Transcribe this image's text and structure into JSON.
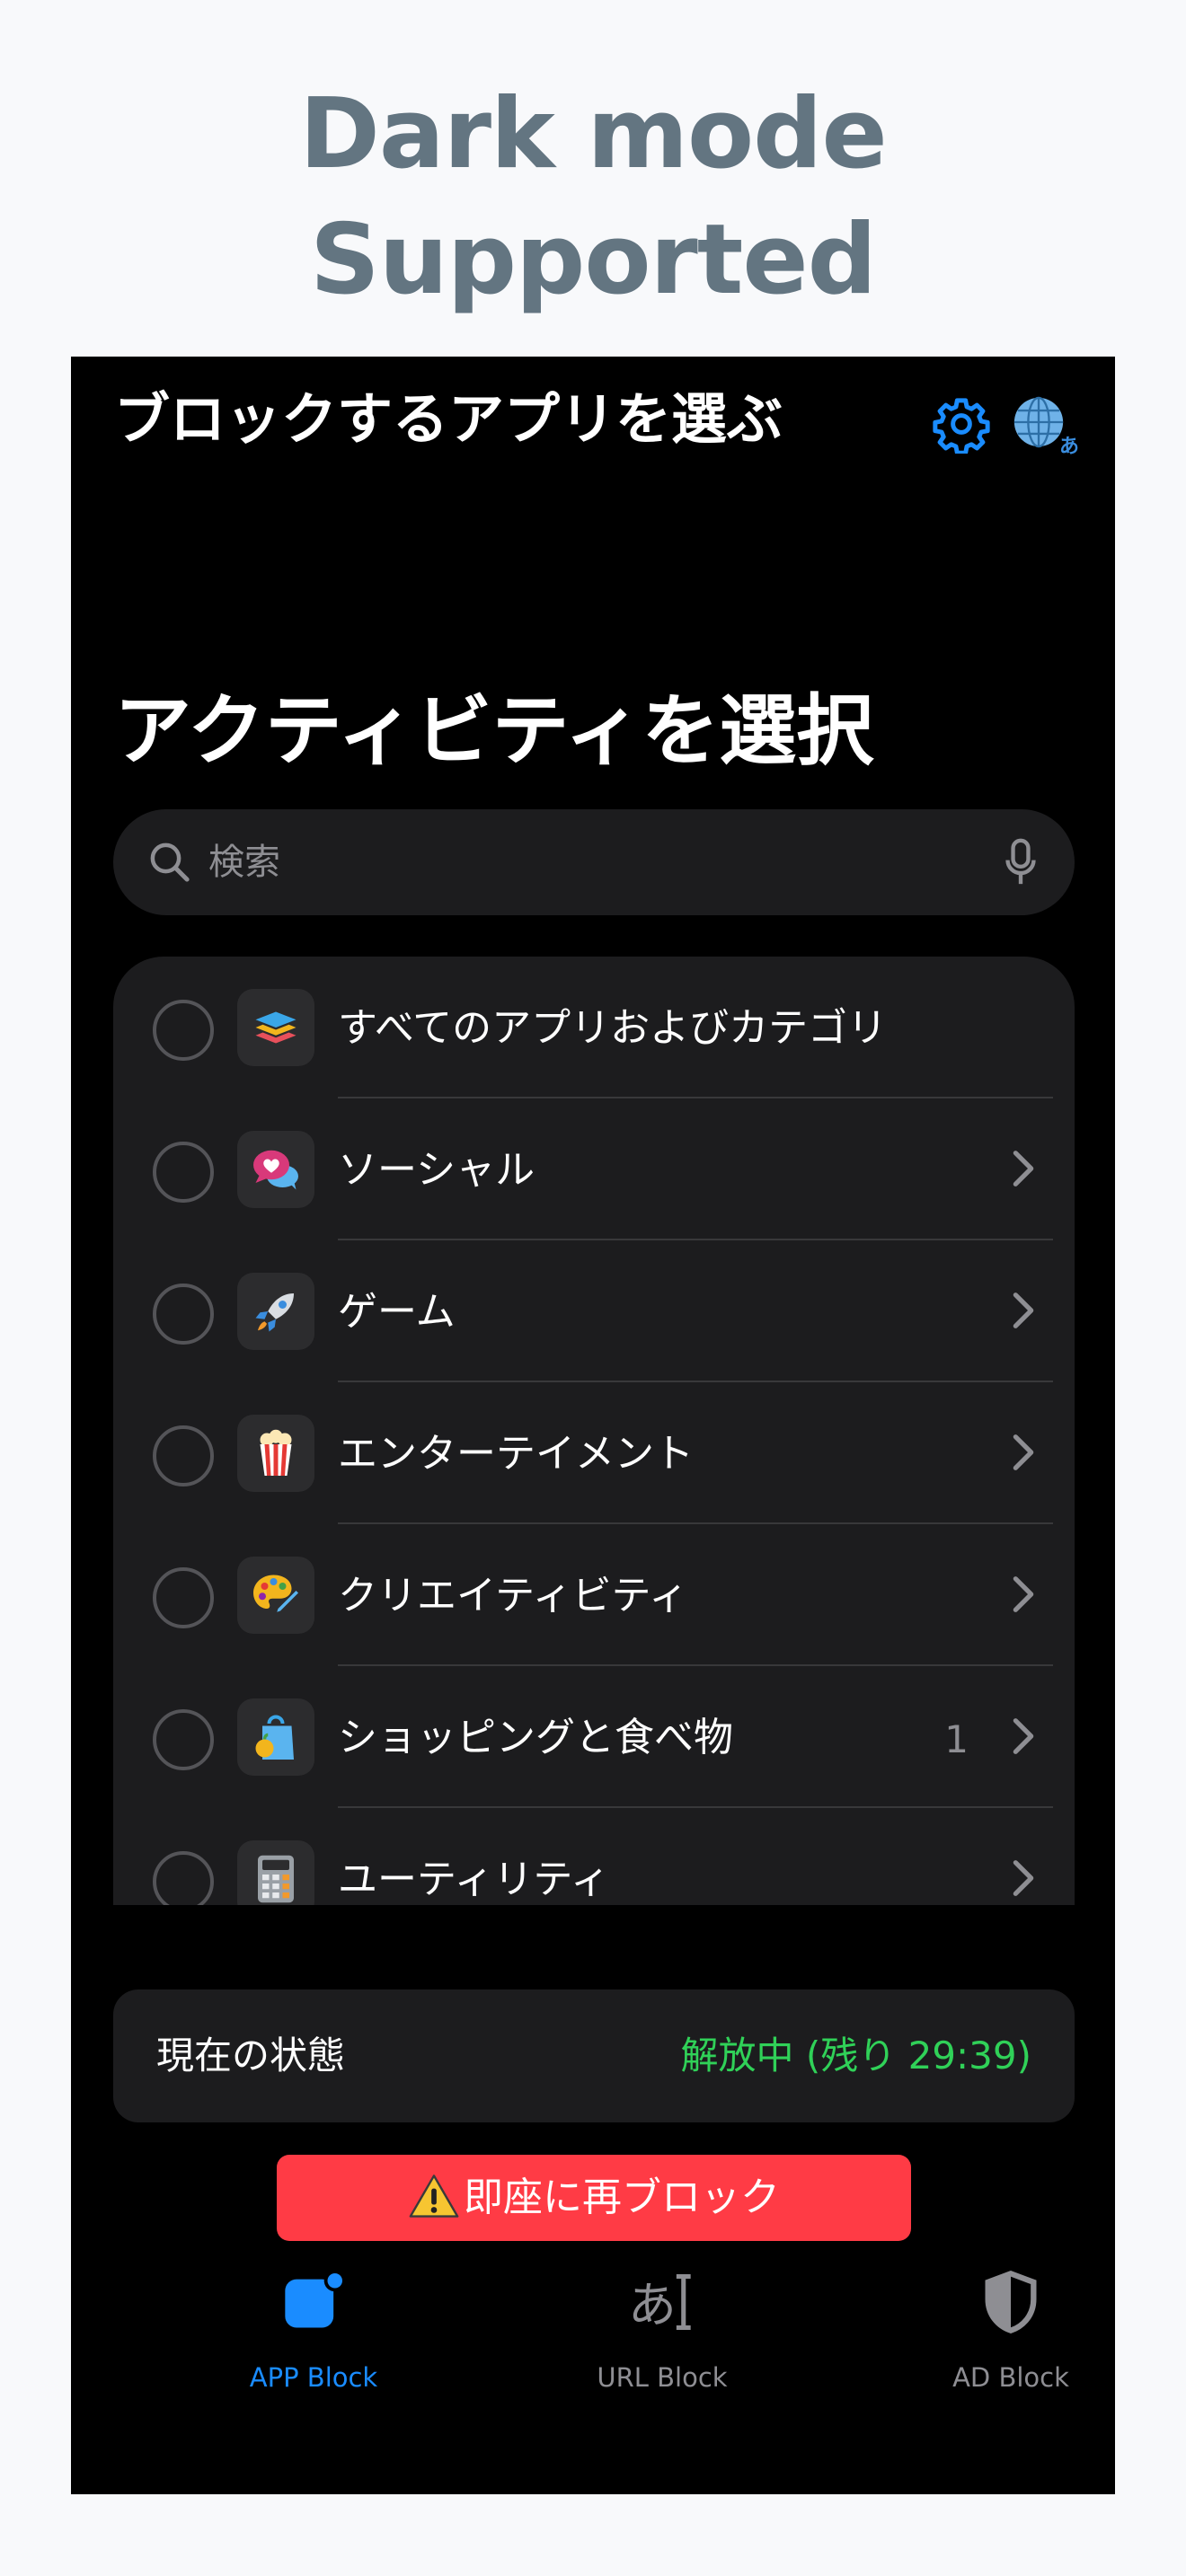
{
  "promo": {
    "line1": "Dark mode",
    "line2": "Supported"
  },
  "header": {
    "title": "ブロックするアプリを選ぶ",
    "globe_badge": "あ"
  },
  "section": {
    "title": "アクティビティを選択"
  },
  "search": {
    "placeholder": "検索"
  },
  "categories": [
    {
      "label": "すべてのアプリおよびカテゴリ",
      "icon": "stack-icon",
      "count": "",
      "chevron": false
    },
    {
      "label": "ソーシャル",
      "icon": "speech-bubbles-icon",
      "count": "",
      "chevron": true
    },
    {
      "label": "ゲーム",
      "icon": "rocket-icon",
      "count": "",
      "chevron": true
    },
    {
      "label": "エンターテイメント",
      "icon": "popcorn-icon",
      "count": "",
      "chevron": true
    },
    {
      "label": "クリエイティビティ",
      "icon": "palette-icon",
      "count": "",
      "chevron": true
    },
    {
      "label": "ショッピングと食べ物",
      "icon": "shopping-bag-icon",
      "count": "1",
      "chevron": true
    },
    {
      "label": "ユーティリティ",
      "icon": "calculator-icon",
      "count": "",
      "chevron": true
    }
  ],
  "status": {
    "label": "現在の状態",
    "value": "解放中 (残り 29:39)",
    "value_color": "#30d158"
  },
  "reblock_button": {
    "label": "即座に再ブロック",
    "color": "#ff3b45"
  },
  "tabs": [
    {
      "label": "APP Block",
      "active": true
    },
    {
      "label": "URL Block",
      "active": false,
      "glyph": "あ"
    },
    {
      "label": "AD Block",
      "active": false
    }
  ],
  "colors": {
    "accent": "#1a8cff",
    "background": "#000000",
    "surface": "#1c1c1e"
  }
}
